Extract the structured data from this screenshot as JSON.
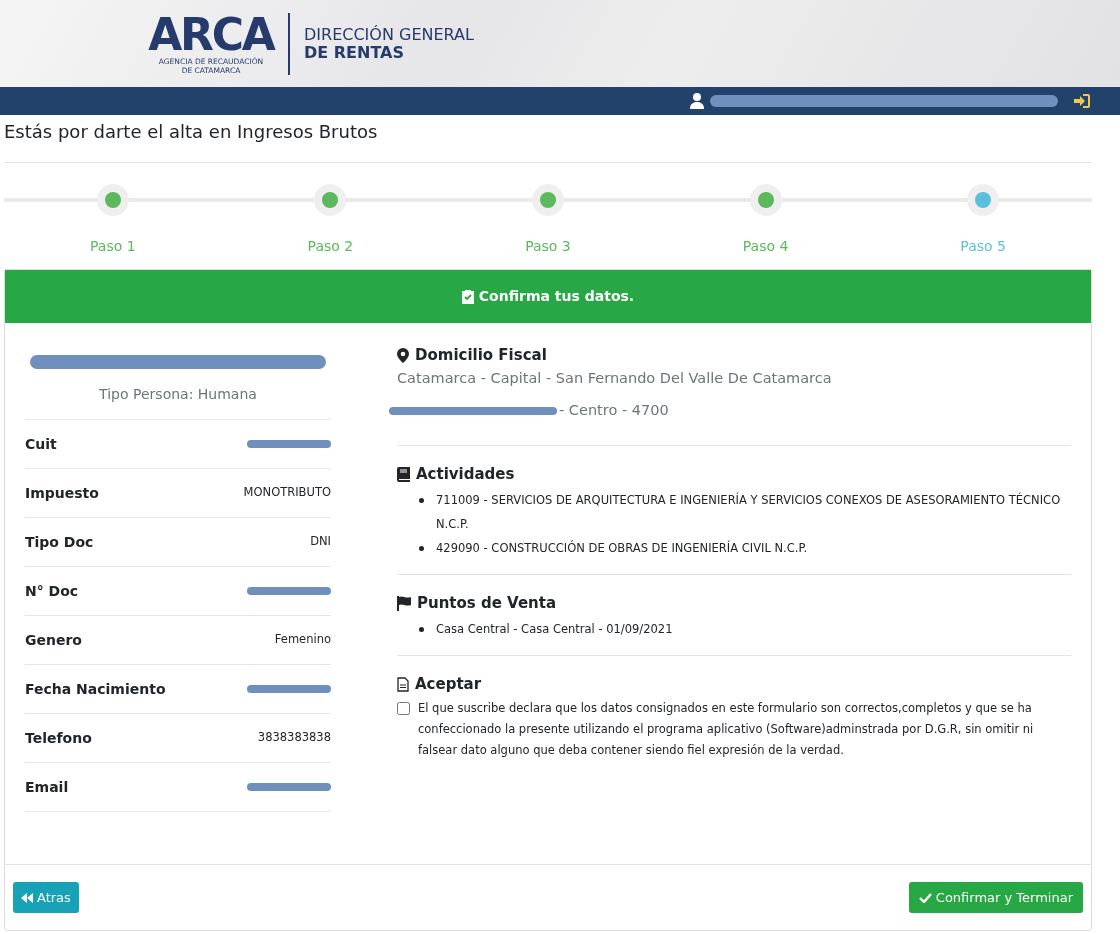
{
  "header": {
    "logo": "ARCA",
    "agency_lines": [
      "AGENCIA DE RECAUDACIÓN",
      "DE CATAMARCA"
    ],
    "department_lines": [
      "DIRECCIÓN GENERAL",
      "DE RENTAS"
    ]
  },
  "user_bar": {
    "user_redacted": true
  },
  "page_title": "Estás por darte el alta en Ingresos Brutos",
  "steps": [
    {
      "label": "Paso 1",
      "completed": true
    },
    {
      "label": "Paso 2",
      "completed": true
    },
    {
      "label": "Paso 3",
      "completed": true
    },
    {
      "label": "Paso 4",
      "completed": true
    },
    {
      "label": "Paso 5",
      "completed": false
    }
  ],
  "card": {
    "title": "Confirma tus datos.",
    "person": {
      "name_redacted": true,
      "type": "Tipo Persona: Humana",
      "fields": [
        {
          "label": "Cuit",
          "redacted": true
        },
        {
          "label": "Impuesto",
          "value": "MONOTRIBUTO"
        },
        {
          "label": "Tipo Doc",
          "value": "DNI"
        },
        {
          "label": "N° Doc",
          "redacted": true
        },
        {
          "label": "Genero",
          "value": "Femenino"
        },
        {
          "label": "Fecha Nacimiento",
          "redacted": true
        },
        {
          "label": "Telefono",
          "value": "3838383838"
        },
        {
          "label": "Email",
          "redacted": true
        }
      ]
    },
    "sections": [
      {
        "kind": "address",
        "title": "Domicilio Fiscal",
        "lines": [
          {
            "text": "Catamarca - Capital - San Fernando Del Valle De Catamarca",
            "redacted_prefix": false
          },
          {
            "text": "- Centro - 4700",
            "redacted_prefix": true
          }
        ]
      },
      {
        "kind": "activities",
        "title": "Actividades",
        "items": [
          "711009 - SERVICIOS DE ARQUITECTURA E INGENIERÍA Y SERVICIOS CONEXOS DE ASESORAMIENTO TÉCNICO N.C.P.",
          "429090 - CONSTRUCCIÓN DE OBRAS DE INGENIERÍA CIVIL N.C.P."
        ]
      },
      {
        "kind": "sales_points",
        "title": "Puntos de Venta",
        "items": [
          "Casa Central - Casa Central - 01/09/2021"
        ]
      },
      {
        "kind": "accept",
        "title": "Aceptar",
        "checked": false,
        "text": "El que suscribe declara que los datos consignados en este formulario son correctos,completos y que se ha confeccionado la presente utilizando el programa aplicativo (Software)adminstrada por D.G.R, sin omitir ni falsear dato alguno que deba contener siendo fiel expresión de la verdad."
      }
    ],
    "buttons": {
      "back": "Atras",
      "confirm": "Confirmar y Terminar"
    }
  }
}
